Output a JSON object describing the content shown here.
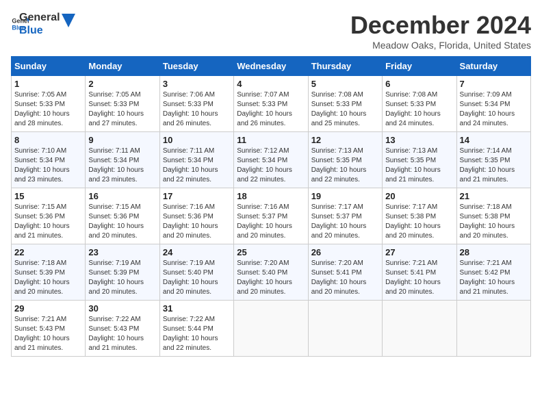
{
  "logo": {
    "line1": "General",
    "line2": "Blue"
  },
  "title": "December 2024",
  "location": "Meadow Oaks, Florida, United States",
  "days_of_week": [
    "Sunday",
    "Monday",
    "Tuesday",
    "Wednesday",
    "Thursday",
    "Friday",
    "Saturday"
  ],
  "weeks": [
    [
      {
        "day": "1",
        "sunrise": "7:05 AM",
        "sunset": "5:33 PM",
        "daylight": "10 hours and 28 minutes."
      },
      {
        "day": "2",
        "sunrise": "7:05 AM",
        "sunset": "5:33 PM",
        "daylight": "10 hours and 27 minutes."
      },
      {
        "day": "3",
        "sunrise": "7:06 AM",
        "sunset": "5:33 PM",
        "daylight": "10 hours and 26 minutes."
      },
      {
        "day": "4",
        "sunrise": "7:07 AM",
        "sunset": "5:33 PM",
        "daylight": "10 hours and 26 minutes."
      },
      {
        "day": "5",
        "sunrise": "7:08 AM",
        "sunset": "5:33 PM",
        "daylight": "10 hours and 25 minutes."
      },
      {
        "day": "6",
        "sunrise": "7:08 AM",
        "sunset": "5:33 PM",
        "daylight": "10 hours and 24 minutes."
      },
      {
        "day": "7",
        "sunrise": "7:09 AM",
        "sunset": "5:34 PM",
        "daylight": "10 hours and 24 minutes."
      }
    ],
    [
      {
        "day": "8",
        "sunrise": "7:10 AM",
        "sunset": "5:34 PM",
        "daylight": "10 hours and 23 minutes."
      },
      {
        "day": "9",
        "sunrise": "7:11 AM",
        "sunset": "5:34 PM",
        "daylight": "10 hours and 23 minutes."
      },
      {
        "day": "10",
        "sunrise": "7:11 AM",
        "sunset": "5:34 PM",
        "daylight": "10 hours and 22 minutes."
      },
      {
        "day": "11",
        "sunrise": "7:12 AM",
        "sunset": "5:34 PM",
        "daylight": "10 hours and 22 minutes."
      },
      {
        "day": "12",
        "sunrise": "7:13 AM",
        "sunset": "5:35 PM",
        "daylight": "10 hours and 22 minutes."
      },
      {
        "day": "13",
        "sunrise": "7:13 AM",
        "sunset": "5:35 PM",
        "daylight": "10 hours and 21 minutes."
      },
      {
        "day": "14",
        "sunrise": "7:14 AM",
        "sunset": "5:35 PM",
        "daylight": "10 hours and 21 minutes."
      }
    ],
    [
      {
        "day": "15",
        "sunrise": "7:15 AM",
        "sunset": "5:36 PM",
        "daylight": "10 hours and 21 minutes."
      },
      {
        "day": "16",
        "sunrise": "7:15 AM",
        "sunset": "5:36 PM",
        "daylight": "10 hours and 20 minutes."
      },
      {
        "day": "17",
        "sunrise": "7:16 AM",
        "sunset": "5:36 PM",
        "daylight": "10 hours and 20 minutes."
      },
      {
        "day": "18",
        "sunrise": "7:16 AM",
        "sunset": "5:37 PM",
        "daylight": "10 hours and 20 minutes."
      },
      {
        "day": "19",
        "sunrise": "7:17 AM",
        "sunset": "5:37 PM",
        "daylight": "10 hours and 20 minutes."
      },
      {
        "day": "20",
        "sunrise": "7:17 AM",
        "sunset": "5:38 PM",
        "daylight": "10 hours and 20 minutes."
      },
      {
        "day": "21",
        "sunrise": "7:18 AM",
        "sunset": "5:38 PM",
        "daylight": "10 hours and 20 minutes."
      }
    ],
    [
      {
        "day": "22",
        "sunrise": "7:18 AM",
        "sunset": "5:39 PM",
        "daylight": "10 hours and 20 minutes."
      },
      {
        "day": "23",
        "sunrise": "7:19 AM",
        "sunset": "5:39 PM",
        "daylight": "10 hours and 20 minutes."
      },
      {
        "day": "24",
        "sunrise": "7:19 AM",
        "sunset": "5:40 PM",
        "daylight": "10 hours and 20 minutes."
      },
      {
        "day": "25",
        "sunrise": "7:20 AM",
        "sunset": "5:40 PM",
        "daylight": "10 hours and 20 minutes."
      },
      {
        "day": "26",
        "sunrise": "7:20 AM",
        "sunset": "5:41 PM",
        "daylight": "10 hours and 20 minutes."
      },
      {
        "day": "27",
        "sunrise": "7:21 AM",
        "sunset": "5:41 PM",
        "daylight": "10 hours and 20 minutes."
      },
      {
        "day": "28",
        "sunrise": "7:21 AM",
        "sunset": "5:42 PM",
        "daylight": "10 hours and 21 minutes."
      }
    ],
    [
      {
        "day": "29",
        "sunrise": "7:21 AM",
        "sunset": "5:43 PM",
        "daylight": "10 hours and 21 minutes."
      },
      {
        "day": "30",
        "sunrise": "7:22 AM",
        "sunset": "5:43 PM",
        "daylight": "10 hours and 21 minutes."
      },
      {
        "day": "31",
        "sunrise": "7:22 AM",
        "sunset": "5:44 PM",
        "daylight": "10 hours and 22 minutes."
      },
      null,
      null,
      null,
      null
    ]
  ],
  "labels": {
    "sunrise": "Sunrise:",
    "sunset": "Sunset:",
    "daylight": "Daylight:"
  }
}
